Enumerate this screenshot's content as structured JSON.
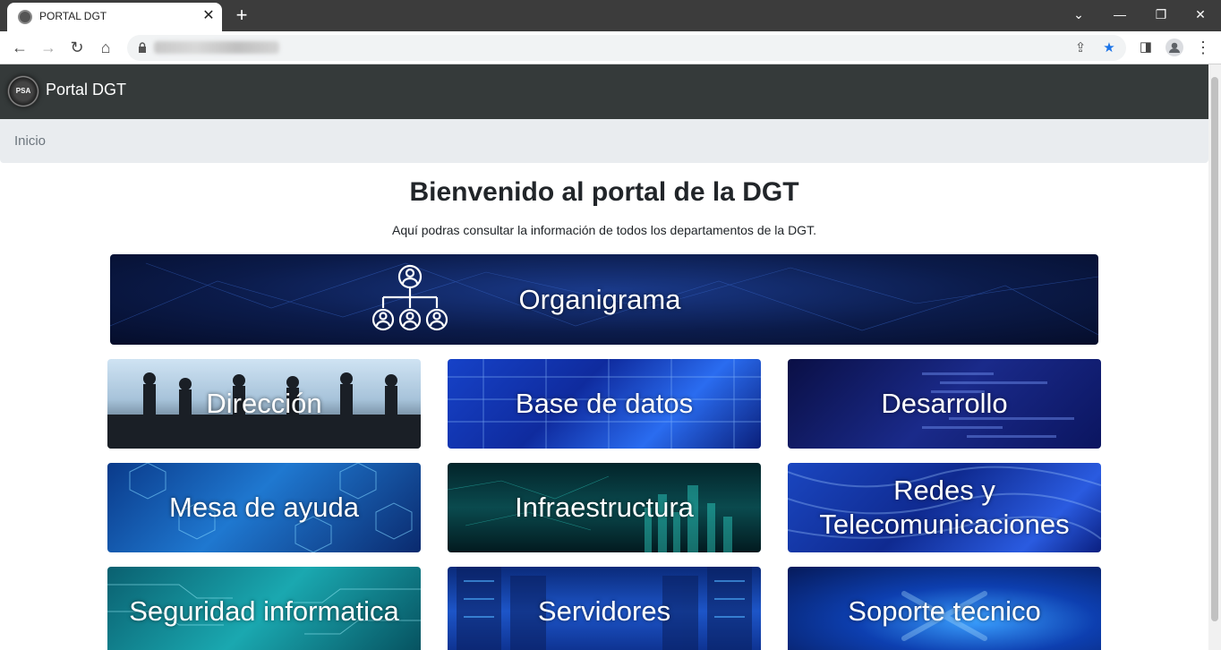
{
  "browser": {
    "tab_title": "PORTAL DGT",
    "new_tab_glyph": "+",
    "close_glyph": "✕"
  },
  "navbar": {
    "logo_text": "PSA",
    "brand": "Portal DGT"
  },
  "breadcrumb": {
    "items": [
      "Inicio"
    ]
  },
  "main": {
    "title": "Bienvenido al portal de la DGT",
    "subtitle": "Aquí podras consultar la información de todos los departamentos de la DGT."
  },
  "tiles": [
    {
      "label": "Organigrama",
      "icon": "org-chart-icon"
    },
    {
      "label": "Dirección"
    },
    {
      "label": "Base de datos"
    },
    {
      "label": "Desarrollo"
    },
    {
      "label": "Mesa de ayuda"
    },
    {
      "label": "Infraestructura"
    },
    {
      "label": "Redes y Telecomunicaciones"
    },
    {
      "label": "Seguridad informatica"
    },
    {
      "label": "Servidores"
    },
    {
      "label": "Soporte tecnico"
    }
  ],
  "colors": {
    "navbar_bg": "#353a3a",
    "breadcrumb_bg": "#e9ecef",
    "tab_strip_bg": "#3c3c3c",
    "bookmark_star": "#1a73e8"
  }
}
